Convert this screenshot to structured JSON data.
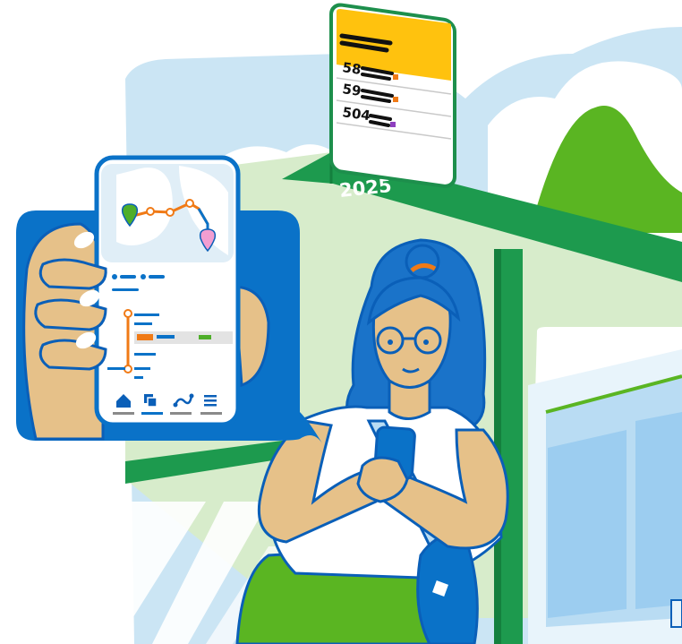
{
  "illustration": {
    "shelter_sign": {
      "year": "2025"
    },
    "departure_board": {
      "rows": [
        {
          "route": "58",
          "accent": "#f07a16"
        },
        {
          "route": "59",
          "accent": "#f07a16"
        },
        {
          "route": "504",
          "accent": "#8e3fbf"
        }
      ],
      "header_color": "#ffc20e",
      "frame_color": "#1d8f4c"
    },
    "phone_app": {
      "nav_icons": [
        "home-icon",
        "map-layers-icon",
        "route-icon",
        "menu-icon"
      ],
      "accent_colors": {
        "route": "#f07a16",
        "start": "#4eae2a",
        "end": "#f29ed1",
        "brand": "#0a72c8"
      }
    },
    "colors": {
      "sky": "#cbe5f4",
      "shelter_green": "#1d9a4e",
      "hill_green": "#5ab522",
      "outline_blue": "#0a5fb8",
      "hair": "#1a73c9",
      "skin": "#e6c189"
    }
  }
}
